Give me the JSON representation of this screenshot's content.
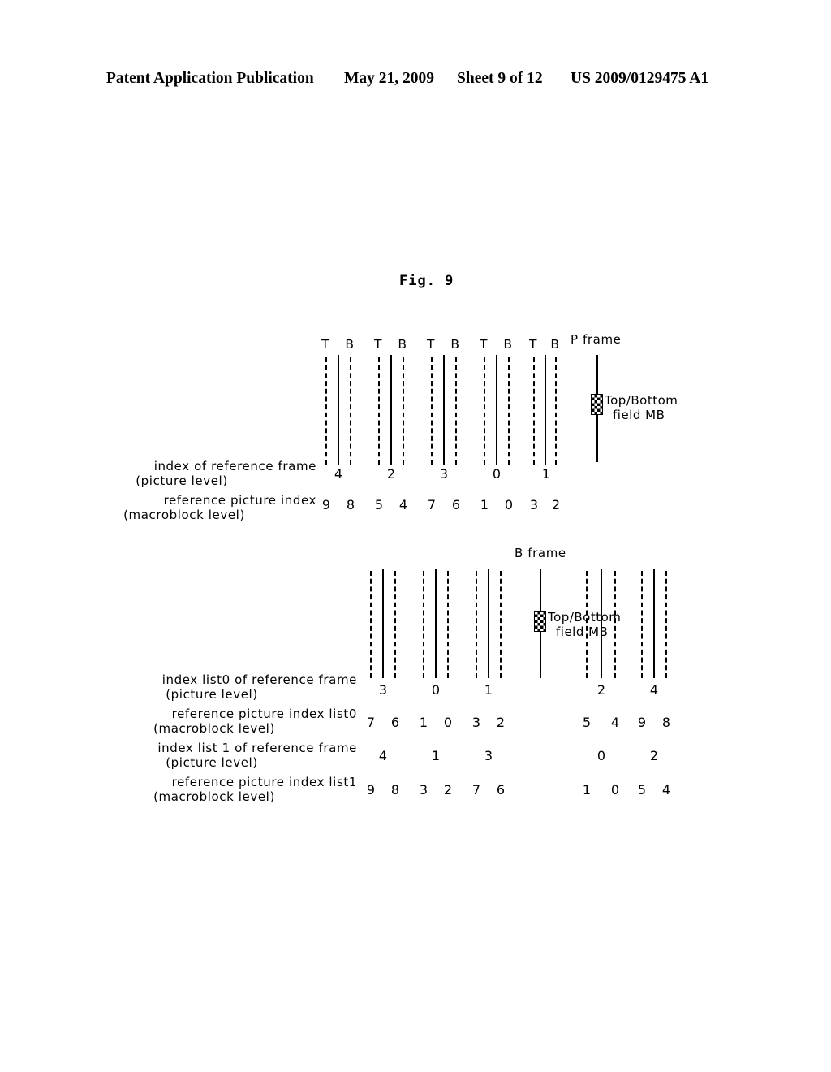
{
  "header": {
    "publication": "Patent Application Publication",
    "date": "May 21, 2009",
    "sheet": "Sheet 9 of 12",
    "patent_number": "US 2009/0129475 A1"
  },
  "figure": {
    "caption": "Fig. 9"
  },
  "legend": {
    "mb_line1": "Top/Bottom",
    "mb_line2": "field MB",
    "mb_icon": "checkered-block-icon"
  },
  "p_frame": {
    "title": "P frame",
    "field_markers": [
      "T",
      "B",
      "T",
      "B",
      "T",
      "B",
      "T",
      "B",
      "T",
      "B"
    ],
    "labels": {
      "picture_level": "index of reference frame",
      "picture_level_sub": "(picture level)",
      "macroblock_level": "reference picture index",
      "macroblock_level_sub": "(macroblock level)"
    },
    "picture_level_values": [
      "4",
      "2",
      "3",
      "0",
      "1"
    ],
    "macroblock_level_values": [
      "9",
      "8",
      "5",
      "4",
      "7",
      "6",
      "1",
      "0",
      "3",
      "2"
    ]
  },
  "b_frame": {
    "title": "B frame",
    "labels": {
      "list0_picture": "index list0 of reference frame",
      "list0_picture_sub": "(picture level)",
      "list0_macroblock": "reference picture index list0",
      "list0_macroblock_sub": "(macroblock level)",
      "list1_picture": "index list 1 of reference frame",
      "list1_picture_sub": "(picture level)",
      "list1_macroblock": "reference picture index list1",
      "list1_macroblock_sub": "(macroblock level)"
    },
    "list0_picture_values": [
      "3",
      "0",
      "1",
      "2",
      "4"
    ],
    "list0_macroblock_values": [
      "7",
      "6",
      "1",
      "0",
      "3",
      "2",
      "5",
      "4",
      "9",
      "8"
    ],
    "list1_picture_values": [
      "4",
      "1",
      "3",
      "0",
      "2"
    ],
    "list1_macroblock_values": [
      "9",
      "8",
      "3",
      "2",
      "7",
      "6",
      "1",
      "0",
      "5",
      "4"
    ]
  }
}
